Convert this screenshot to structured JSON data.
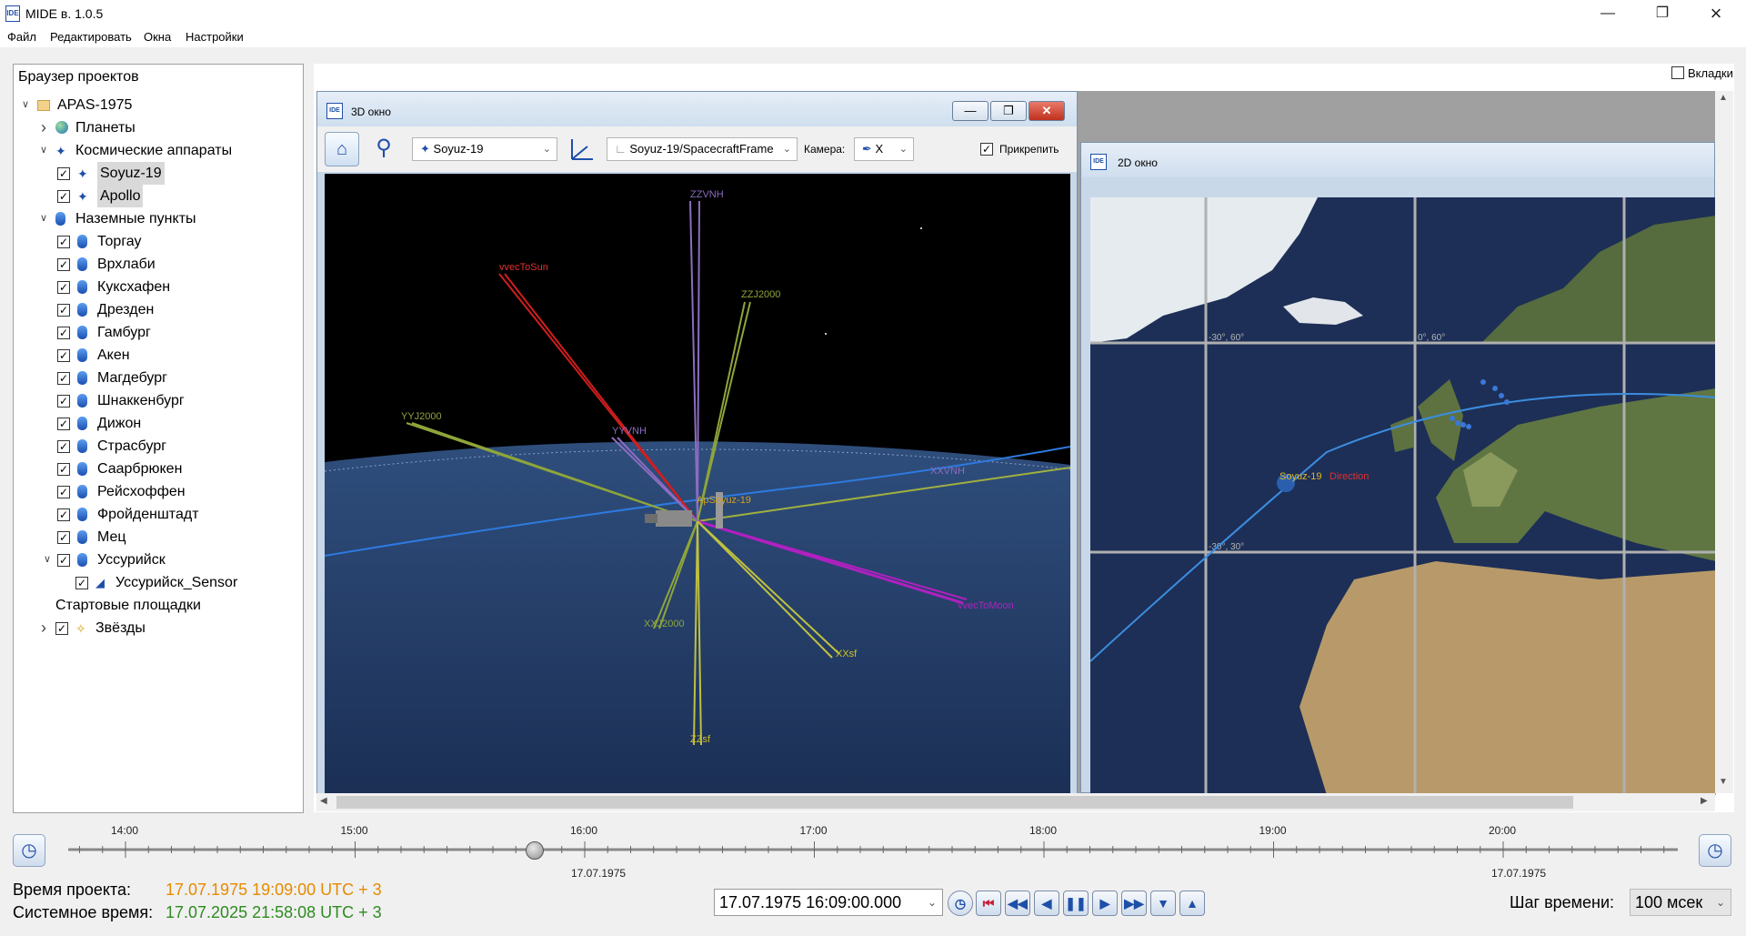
{
  "app": {
    "title": "MIDE в. 1.0.5",
    "colors": {
      "accent": "#1e4fa8",
      "project_time": "#e68a00",
      "system_time": "#2e8b20"
    }
  },
  "menu": {
    "items": [
      "Файл",
      "Редактировать",
      "Окна",
      "Настройки"
    ]
  },
  "tabs_toggle": {
    "label": "Вкладки"
  },
  "browser": {
    "title": "Браузер проектов",
    "project": "APAS-1975",
    "planets": "Планеты",
    "spacecraft_group": "Космические аппараты",
    "spacecraft": [
      "Soyuz-19",
      "Apollo"
    ],
    "ground_group": "Наземные пункты",
    "ground": [
      "Торгау",
      "Врхлаби",
      "Куксхафен",
      "Дрезден",
      "Гамбург",
      "Акен",
      "Магдебург",
      "Шнаккенбург",
      "Дижон",
      "Страсбург",
      "Саарбрюкен",
      "Рейсхоффен",
      "Фройденштадт",
      "Мец",
      "Уссурийск"
    ],
    "sensor": "Уссурийск_Sensor",
    "launch": "Стартовые площадки",
    "stars": "Звёзды"
  },
  "win3d": {
    "title": "3D окно",
    "object_select": "Soyuz-19",
    "frame_select": "Soyuz-19/SpacecraftFrame",
    "camera_label": "Камера:",
    "camera_value": "X",
    "attach_label": "Прикрепить",
    "scene_labels": {
      "sc": "Soyuz-19",
      "a": "ApSoyuz-19",
      "zvnh": "ZZVNH",
      "yvnh": "YYVNH",
      "xvnh": "XXVNH",
      "vsun": "vvecToSun",
      "vmoon": "vvecToMoon",
      "z2000": "ZZJ2000",
      "y2000": "YYJ2000",
      "x2000": "XXJ2000",
      "xsf": "XXsf",
      "zsf": "ZZsf"
    }
  },
  "win2d": {
    "title": "2D окно",
    "grid_labels": [
      "-30°, 60°",
      "0°, 60°",
      "-30°, 30°"
    ],
    "sc_label": "Soyuz-19",
    "sun_label": "Direction"
  },
  "timeline": {
    "hours": [
      "14:00",
      "15:00",
      "16:00",
      "17:00",
      "18:00",
      "19:00",
      "20:00"
    ],
    "dates": [
      "17.07.1975",
      "17.07.1975"
    ],
    "position": 0.29
  },
  "status": {
    "project_time_label": "Время проекта:",
    "project_time": "17.07.1975 19:09:00 UTC + 3",
    "system_time_label": "Системное время:",
    "system_time": "17.07.2025 21:58:08 UTC + 3",
    "current_time": "17.07.1975 16:09:00.000",
    "step_label": "Шаг времени:",
    "step_value": "100 мсек"
  }
}
